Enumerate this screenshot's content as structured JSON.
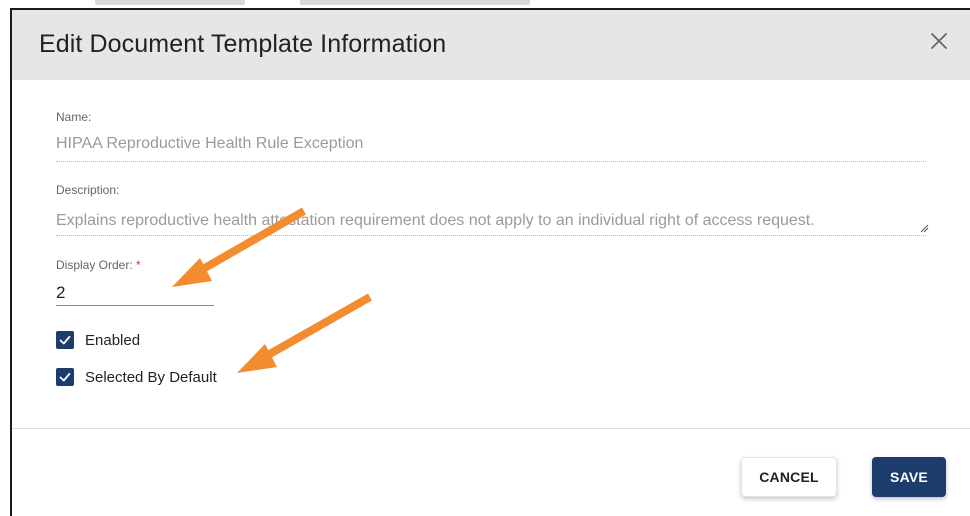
{
  "dialog": {
    "title": "Edit Document Template Information"
  },
  "fields": {
    "name": {
      "label": "Name:",
      "value": "HIPAA Reproductive Health Rule Exception"
    },
    "description": {
      "label": "Description:",
      "value": "Explains reproductive health attestation requirement does not apply to an individual right of access request."
    },
    "display_order": {
      "label": "Display Order:",
      "required_marker": "*",
      "value": "2"
    }
  },
  "checkboxes": {
    "enabled": {
      "label": "Enabled",
      "checked": true
    },
    "selected_by_default": {
      "label": "Selected By Default",
      "checked": true
    }
  },
  "buttons": {
    "cancel_label": "CANCEL",
    "save_label": "SAVE"
  },
  "colors": {
    "primary": "#1c3d6b",
    "header_bg": "#e6e6e6",
    "annotation_arrow": "#f28c2e",
    "required": "#d32f2f"
  },
  "icons": {
    "close": "close-icon",
    "checkbox": "checkmark-icon",
    "annotation": "arrow-icon"
  }
}
